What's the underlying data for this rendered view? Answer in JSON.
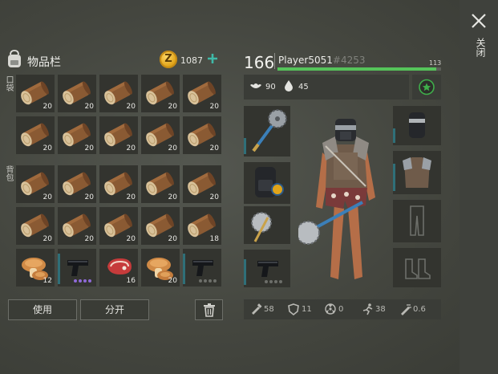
{
  "close": {
    "icon": "close-icon",
    "label": "关闭"
  },
  "inventory": {
    "title": "物品栏",
    "coins": "1087",
    "pocket_label": "口袋",
    "backpack_label": "背包",
    "pocket_rows": [
      [
        {
          "item": "wood-log",
          "count": "20"
        },
        {
          "item": "wood-log",
          "count": "20"
        },
        {
          "item": "wood-log",
          "count": "20"
        },
        {
          "item": "wood-log",
          "count": "20"
        },
        {
          "item": "wood-log",
          "count": "20"
        }
      ],
      [
        {
          "item": "wood-log",
          "count": "20"
        },
        {
          "item": "wood-log",
          "count": "20"
        },
        {
          "item": "wood-log",
          "count": "20"
        },
        {
          "item": "wood-log",
          "count": "20"
        },
        {
          "item": "wood-log",
          "count": "20"
        }
      ]
    ],
    "backpack_rows": [
      [
        {
          "item": "wood-log",
          "count": "20"
        },
        {
          "item": "wood-log",
          "count": "20"
        },
        {
          "item": "wood-log",
          "count": "20"
        },
        {
          "item": "wood-log",
          "count": "20"
        },
        {
          "item": "wood-log",
          "count": "20"
        }
      ],
      [
        {
          "item": "wood-log",
          "count": "20"
        },
        {
          "item": "wood-log",
          "count": "20"
        },
        {
          "item": "wood-log",
          "count": "20"
        },
        {
          "item": "wood-log",
          "count": "20"
        },
        {
          "item": "wood-log",
          "count": "18"
        }
      ],
      [
        {
          "item": "mushroom",
          "count": "12"
        },
        {
          "item": "pistol",
          "count": ""
        },
        {
          "item": "raw-meat",
          "count": "16"
        },
        {
          "item": "mushroom",
          "count": "20"
        },
        {
          "item": "pistol",
          "count": ""
        }
      ]
    ],
    "buttons": {
      "use": "使用",
      "split": "分开",
      "trash": "trash-icon"
    }
  },
  "character": {
    "level": "166",
    "name": "Player5051",
    "tag": "#4253",
    "xp_max": "113",
    "xp_fraction": 0.97,
    "hunger": "90",
    "thirst": "45",
    "perk_icon": "star-icon",
    "bottom_stats": [
      {
        "icon": "weapon-damage-icon",
        "value": "58"
      },
      {
        "icon": "armor-icon",
        "value": "11"
      },
      {
        "icon": "radiation-icon",
        "value": "0"
      },
      {
        "icon": "speed-icon",
        "value": "38"
      },
      {
        "icon": "attack-speed-icon",
        "value": "0.6"
      }
    ]
  },
  "colors": {
    "xp_green": "#55c45a",
    "accent_teal": "#2f6f78",
    "perk_green": "#3fae4a"
  }
}
